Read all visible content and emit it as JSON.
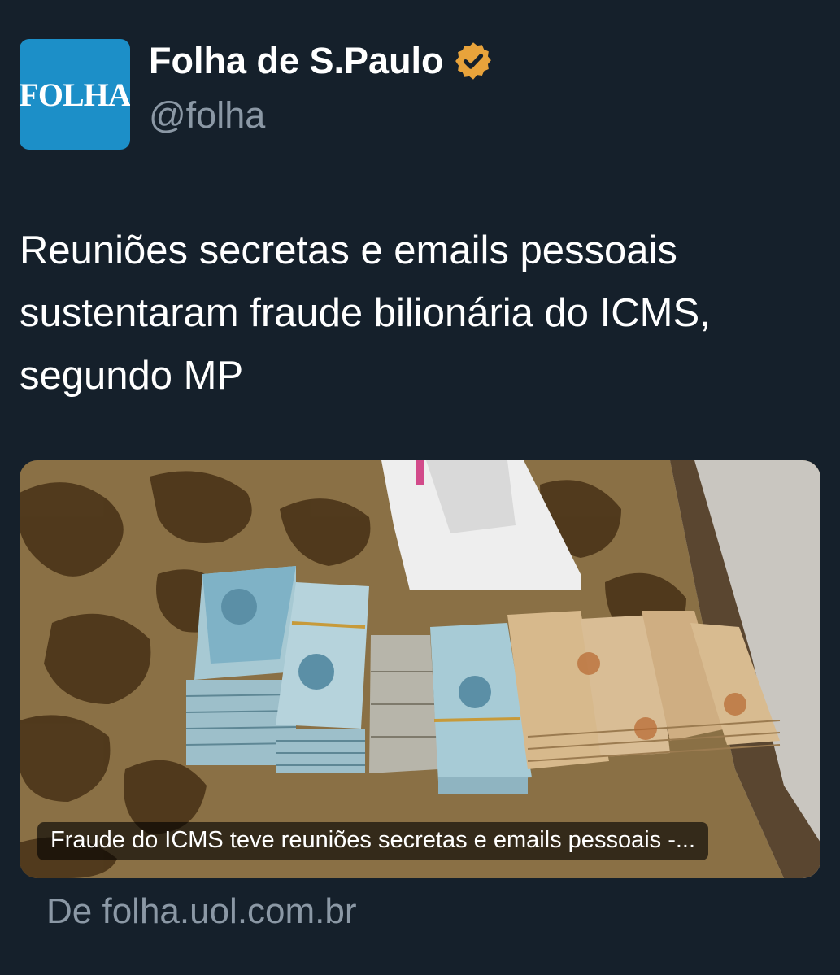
{
  "author": {
    "display_name": "Folha de S.Paulo",
    "handle": "@folha",
    "avatar_text": "FOLHA",
    "avatar_color": "#1c8fc8",
    "verified_badge_icon": "verified-badge-icon",
    "verified_badge_color": "#e8a33b"
  },
  "tweet": {
    "text": "Reuniões secretas e emails pessoais sustentaram fraude bilionária do ICMS, segundo MP"
  },
  "link_card": {
    "image_icon": "cash-stacks-photo",
    "caption": "Fraude do ICMS teve reuniões secretas e emails pessoais -...",
    "source": "De folha.uol.com.br"
  },
  "colors": {
    "background": "#15202b",
    "text_primary": "#ffffff",
    "text_secondary": "#8b98a5"
  }
}
